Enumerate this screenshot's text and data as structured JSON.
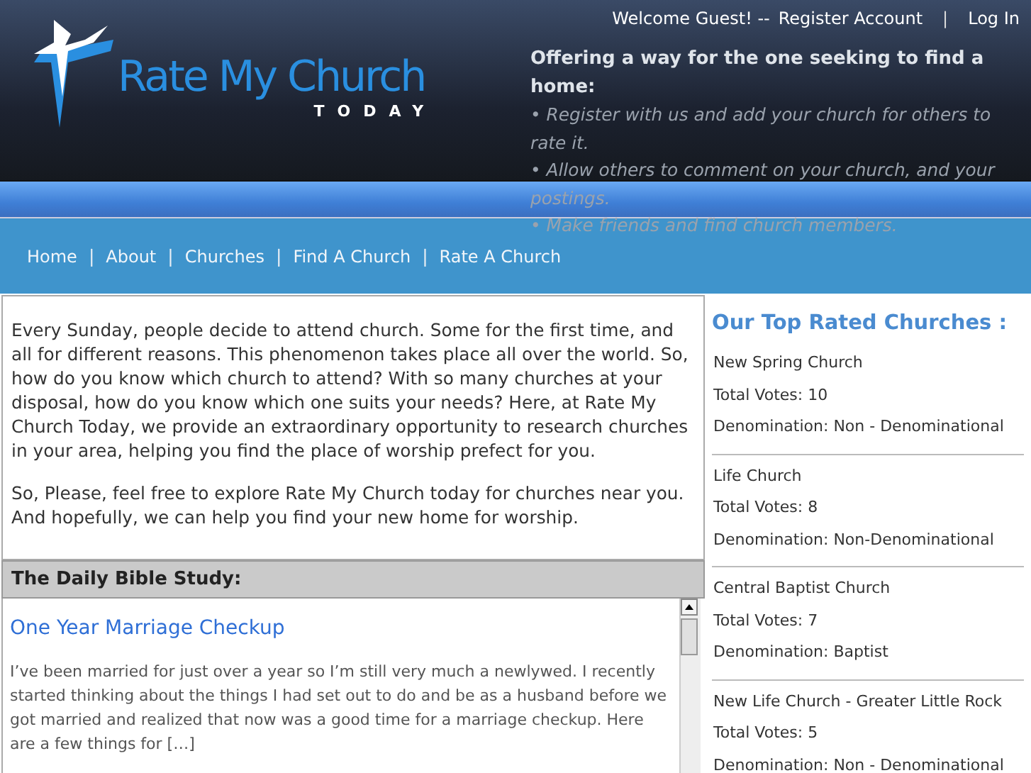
{
  "header": {
    "logo": {
      "title": "Rate My Church",
      "subtitle": "TODAY"
    },
    "account": {
      "greeting": "Welcome Guest! --",
      "register": "Register Account",
      "separator": "|",
      "login": "Log In"
    },
    "tagline": {
      "heading": "Offering a way for the one seeking to find a home:",
      "points": [
        "• Register with us and add your church for others to rate it.",
        "• Allow others to comment on your church, and your postings.",
        "• Make friends and find church members."
      ]
    }
  },
  "nav": {
    "items": [
      "Home",
      "About",
      "Churches",
      "Find A Church",
      "Rate A Church"
    ],
    "separator": "|"
  },
  "intro": {
    "paragraphs": [
      "Every Sunday, people decide to attend church. Some for the first time, and all for different reasons. This phenomenon takes place all over the world. So, how do you know which church to attend? With so many churches at your disposal, how do you know which one suits your needs? Here, at Rate My Church Today, we provide an extraordinary opportunity to research churches in your area, helping you find the place of worship prefect for you.",
      "So, Please, feel free to explore Rate My  Church today for churches near you. And hopefully, we can help you find your new home for worship."
    ]
  },
  "bible_study": {
    "heading": "The Daily Bible Study:",
    "post_title": "One Year Marriage Checkup",
    "excerpt": "I’ve been married for just over a year so I’m still very much a newlywed. I recently started thinking about the things I had set out to do and be as a husband before we got married and realized that now was a good time for a marriage checkup. Here are a few things for […]"
  },
  "top_rated": {
    "heading": "Our Top Rated Churches :",
    "churches": [
      {
        "name": "New Spring Church",
        "votes": "Total Votes: 10",
        "denomination": "Denomination: Non - Denominational"
      },
      {
        "name": "Life Church",
        "votes": "Total Votes: 8",
        "denomination": "Denomination: Non-Denominational"
      },
      {
        "name": "Central Baptist Church",
        "votes": "Total Votes: 7",
        "denomination": "Denomination: Baptist"
      },
      {
        "name": "New Life Church - Greater Little Rock",
        "votes": "Total Votes: 5",
        "denomination": "Denomination: Non - Denominational"
      }
    ]
  }
}
